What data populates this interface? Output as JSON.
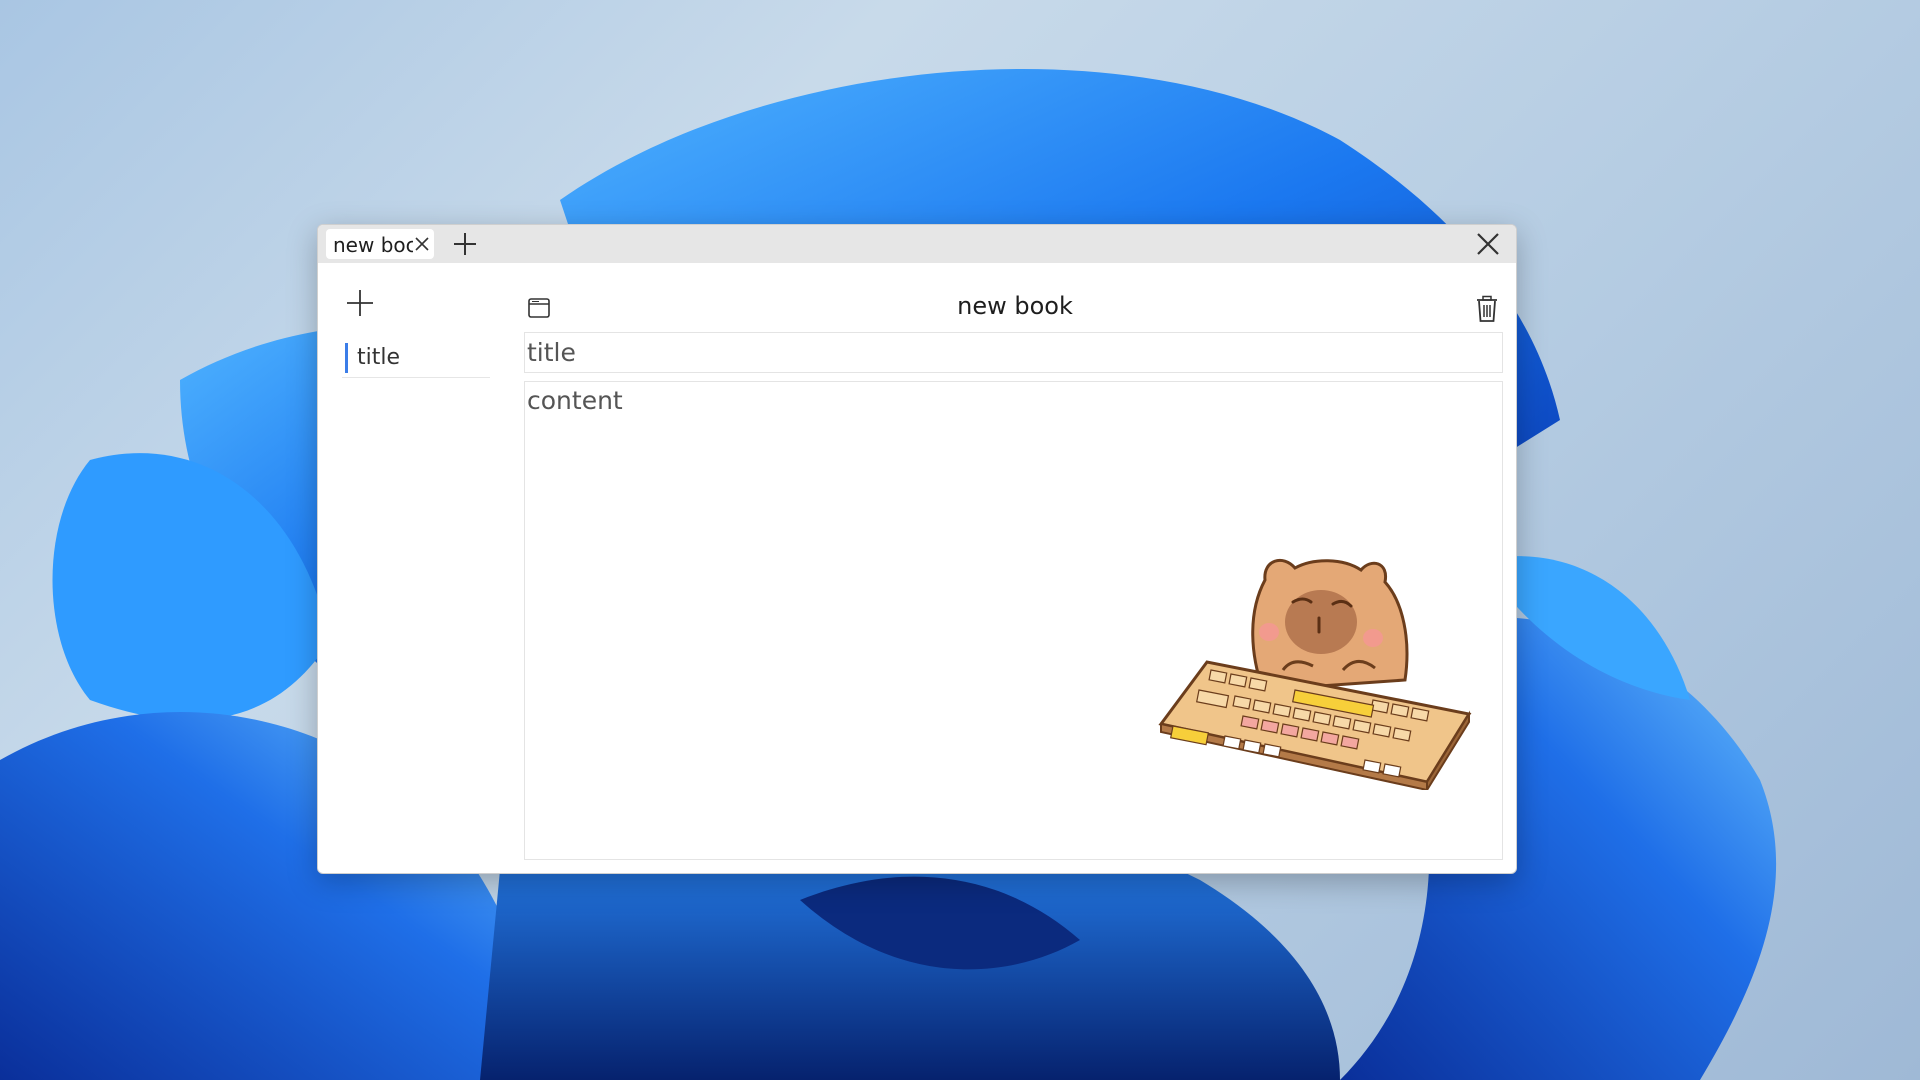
{
  "window": {
    "tabs": [
      {
        "label": "new boc"
      }
    ]
  },
  "sidebar": {
    "pages": [
      {
        "label": "title"
      }
    ]
  },
  "editor": {
    "book_title": "new book",
    "title_placeholder": "title",
    "content_placeholder": "content"
  },
  "icons": {
    "tab_close": "close-icon",
    "tab_add": "plus-icon",
    "window_close": "close-icon",
    "sidebar_add": "plus-icon",
    "book": "window-icon",
    "delete": "trash-icon"
  },
  "colors": {
    "accent": "#3b7de8",
    "titlebar": "#e6e6e6",
    "wallpaper_blue": "#1a6df0"
  }
}
